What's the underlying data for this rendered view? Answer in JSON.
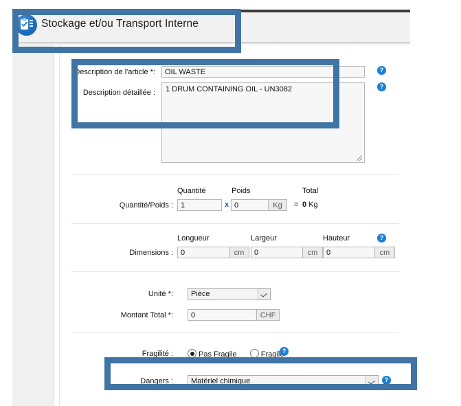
{
  "header": {
    "title": "Stockage et/ou Transport Interne",
    "icon": "clipboard-form-icon"
  },
  "colors": {
    "highlight": "#4074a5",
    "help_icon": "#1c7fd6",
    "operator": "#1b5fa8",
    "topbar": "#3b3b3b"
  },
  "form": {
    "article_description": {
      "label": "Description de l'article *:",
      "value": "OIL WASTE"
    },
    "detailed_description": {
      "label": "Description détaillée :",
      "value": "1 DRUM CONTAINING OIL - UN3082"
    },
    "quantity_weight": {
      "label": "Quantité/Poids :",
      "quantity_header": "Quantité",
      "quantity_value": "1",
      "operator_multiply": "x",
      "weight_header": "Poids",
      "weight_value": "0",
      "weight_unit": "Kg",
      "operator_equals": "=",
      "total_header": "Total",
      "total_value": "0",
      "total_unit": "Kg"
    },
    "dimensions": {
      "label": "Dimensions :",
      "length_header": "Longueur",
      "length_value": "0",
      "length_unit": "cm",
      "width_header": "Largeur",
      "width_value": "0",
      "width_unit": "cm",
      "height_header": "Hauteur",
      "height_value": "0",
      "height_unit": "cm"
    },
    "unit": {
      "label": "Unité *:",
      "value": "Pièce"
    },
    "total_amount": {
      "label": "Montant Total *:",
      "value": "0",
      "currency": "CHF"
    },
    "fragility": {
      "label": "Fragilité :",
      "option_not_fragile": "Pas Fragile",
      "option_fragile": "Fragile",
      "selected": "Pas Fragile"
    },
    "dangers": {
      "label": "Dangers :",
      "value": "Matériel chimique"
    },
    "help_icon_label": "?"
  }
}
